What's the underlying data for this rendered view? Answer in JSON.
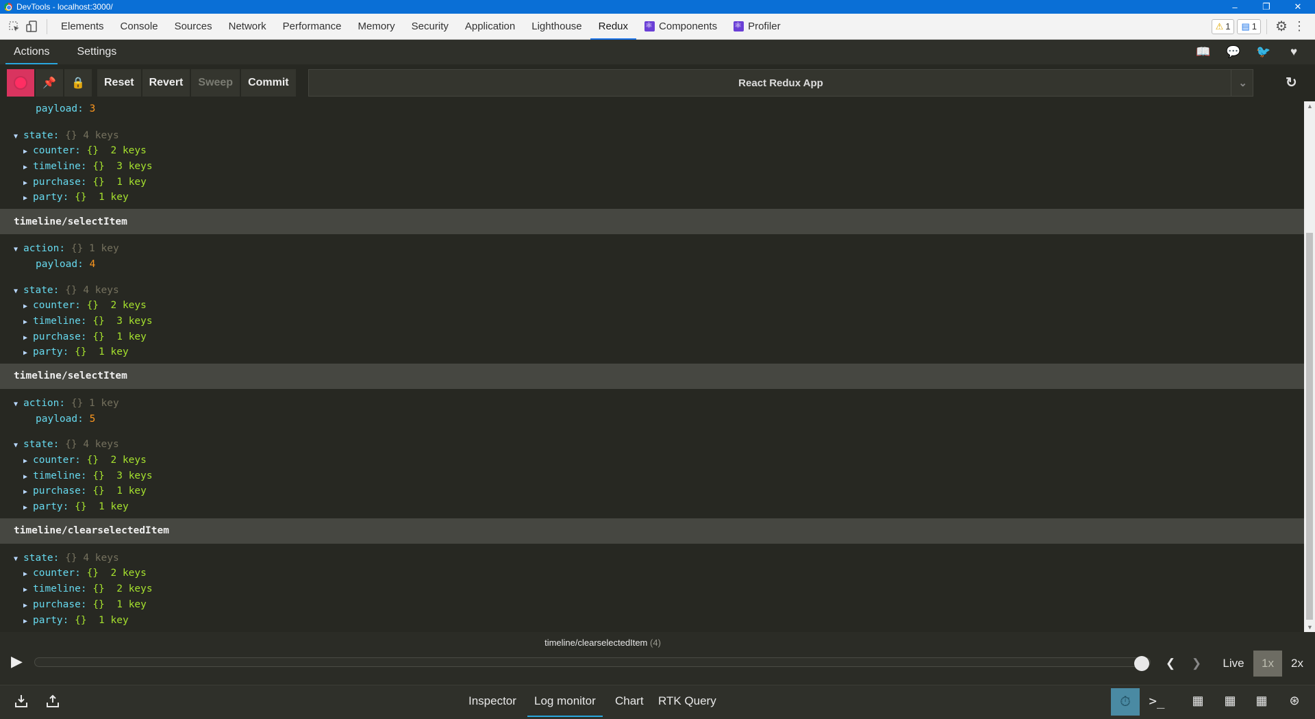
{
  "window": {
    "title": "DevTools - localhost:3000/"
  },
  "devtools_tabs": [
    {
      "label": "Elements"
    },
    {
      "label": "Console"
    },
    {
      "label": "Sources"
    },
    {
      "label": "Network"
    },
    {
      "label": "Performance"
    },
    {
      "label": "Memory"
    },
    {
      "label": "Security"
    },
    {
      "label": "Application"
    },
    {
      "label": "Lighthouse"
    },
    {
      "label": "Redux"
    },
    {
      "label": "Components"
    },
    {
      "label": "Profiler"
    }
  ],
  "badges": {
    "warnings": "1",
    "messages": "1"
  },
  "subtabs": {
    "actions": "Actions",
    "settings": "Settings"
  },
  "toolbar": {
    "reset": "Reset",
    "revert": "Revert",
    "sweep": "Sweep",
    "commit": "Commit",
    "instance": "React Redux App"
  },
  "log": {
    "first": {
      "payload_key": "payload:",
      "payload_val": "3",
      "state_key": "state:",
      "state_meta": "{} 4 keys",
      "counter": "counter:",
      "counter_meta": "{}  2 keys",
      "timeline": "timeline:",
      "timeline_meta": "{}  3 keys",
      "purchase": "purchase:",
      "purchase_meta": "{}  1 key",
      "party": "party:",
      "party_meta": "{}  1 key"
    },
    "e1": {
      "title": "timeline/selectItem",
      "action_key": "action:",
      "action_meta": "{} 1 key",
      "payload_key": "payload:",
      "payload_val": "4",
      "state_key": "state:",
      "state_meta": "{} 4 keys",
      "counter": "counter:",
      "counter_meta": "{}  2 keys",
      "timeline": "timeline:",
      "timeline_meta": "{}  3 keys",
      "purchase": "purchase:",
      "purchase_meta": "{}  1 key",
      "party": "party:",
      "party_meta": "{}  1 key"
    },
    "e2": {
      "title": "timeline/selectItem",
      "action_key": "action:",
      "action_meta": "{} 1 key",
      "payload_key": "payload:",
      "payload_val": "5",
      "state_key": "state:",
      "state_meta": "{} 4 keys",
      "counter": "counter:",
      "counter_meta": "{}  2 keys",
      "timeline": "timeline:",
      "timeline_meta": "{}  3 keys",
      "purchase": "purchase:",
      "purchase_meta": "{}  1 key",
      "party": "party:",
      "party_meta": "{}  1 key"
    },
    "e3": {
      "title": "timeline/clearselectedItem",
      "state_key": "state:",
      "state_meta": "{} 4 keys",
      "counter": "counter:",
      "counter_meta": "{}  2 keys",
      "timeline": "timeline:",
      "timeline_meta": "{}  2 keys",
      "purchase": "purchase:",
      "purchase_meta": "{}  1 key",
      "party": "party:",
      "party_meta": "{}  1 key"
    }
  },
  "slider": {
    "current_action": "timeline/clearselectedItem",
    "current_index": "(4)",
    "position": 1.0,
    "live": "Live",
    "speed_1x": "1x",
    "speed_2x": "2x"
  },
  "bottom_tabs": {
    "inspector": "Inspector",
    "log_monitor": "Log monitor",
    "chart": "Chart",
    "rtk_query": "RTK Query"
  },
  "colors": {
    "accent": "#2aa7df",
    "record": "#ff2e63",
    "background": "#272822"
  }
}
